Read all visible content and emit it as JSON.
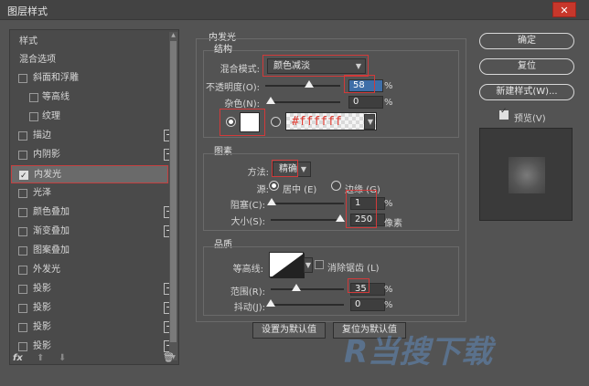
{
  "window": {
    "title": "图层样式",
    "close_icon": "close-icon"
  },
  "left": {
    "header": "样式",
    "blend_options": "混合选项",
    "items": [
      {
        "label": "斜面和浮雕",
        "checked": false,
        "plus": false
      },
      {
        "label": "等高线",
        "checked": false,
        "plus": false,
        "sub": true
      },
      {
        "label": "纹理",
        "checked": false,
        "plus": false,
        "sub": true
      },
      {
        "label": "描边",
        "checked": false,
        "plus": true
      },
      {
        "label": "内阴影",
        "checked": false,
        "plus": true
      },
      {
        "label": "内发光",
        "checked": true,
        "plus": false,
        "selected": true
      },
      {
        "label": "光泽",
        "checked": false,
        "plus": false
      },
      {
        "label": "颜色叠加",
        "checked": false,
        "plus": true
      },
      {
        "label": "渐变叠加",
        "checked": false,
        "plus": true
      },
      {
        "label": "图案叠加",
        "checked": false,
        "plus": false
      },
      {
        "label": "外发光",
        "checked": false,
        "plus": false
      },
      {
        "label": "投影",
        "checked": false,
        "plus": true
      },
      {
        "label": "投影",
        "checked": false,
        "plus": true
      },
      {
        "label": "投影",
        "checked": false,
        "plus": true
      },
      {
        "label": "投影",
        "checked": false,
        "plus": true
      }
    ],
    "footer_fx": "fx"
  },
  "inner_glow": {
    "title": "内发光",
    "structure": {
      "title": "结构",
      "blend_mode_label": "混合模式:",
      "blend_mode_value": "颜色减淡",
      "opacity_label": "不透明度(O):",
      "opacity_value": "58",
      "noise_label": "杂色(N):",
      "noise_value": "0",
      "percent": "%",
      "color_hex": "#ffffff",
      "opacity_fraction": 0.58,
      "noise_fraction": 0.0
    },
    "elements": {
      "title": "图素",
      "method_label": "方法:",
      "method_value": "精确",
      "source_label": "源:",
      "source_center": "居中 (E)",
      "source_edge": "边缘 (G)",
      "choke_label": "阻塞(C):",
      "choke_value": "1",
      "size_label": "大小(S):",
      "size_value": "250",
      "size_unit": "像素",
      "percent": "%",
      "choke_fraction": 0.01,
      "size_fraction": 0.95
    },
    "quality": {
      "title": "品质",
      "contour_label": "等高线:",
      "antialias_label": "消除锯齿 (L)",
      "range_label": "范围(R):",
      "range_value": "35",
      "jitter_label": "抖动(J):",
      "jitter_value": "0",
      "percent": "%",
      "range_fraction": 0.35,
      "jitter_fraction": 0.0
    },
    "buttons": {
      "set_default": "设置为默认值",
      "reset_default": "复位为默认值"
    }
  },
  "right": {
    "ok": "确定",
    "reset": "复位",
    "new_style": "新建样式(W)...",
    "preview_label": "预览(V)"
  },
  "watermark": "R当搜下载"
}
